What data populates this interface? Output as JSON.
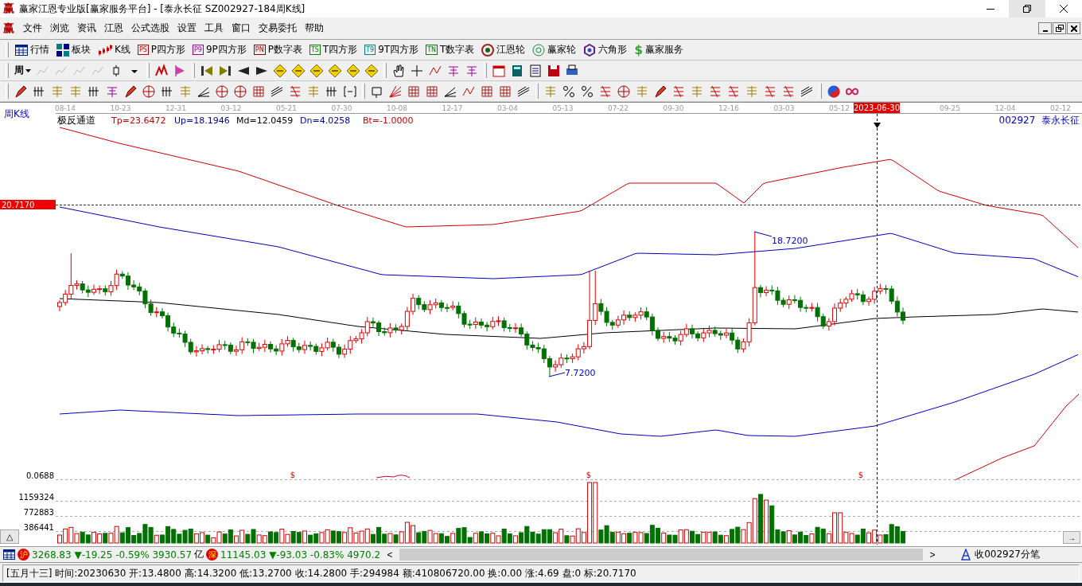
{
  "window": {
    "logo": "赢",
    "title": "赢家江恩专业版[赢家服务平台] - [泰永长征  SZ002927-184周K线]"
  },
  "menu": {
    "logo": "赢",
    "items": [
      "文件",
      "浏览",
      "资讯",
      "江恩",
      "公式选股",
      "设置",
      "工具",
      "窗口",
      "交易委托",
      "帮助"
    ]
  },
  "toolbar": [
    {
      "label": "行情",
      "kind": "table"
    },
    {
      "label": "板块",
      "kind": "blocks"
    },
    {
      "label": "K线",
      "kind": "candles"
    },
    {
      "label": "P四方形",
      "kind": "badge",
      "badge": "PS",
      "color": "#c00000"
    },
    {
      "label": "9P四方形",
      "kind": "badge",
      "badge": "P9",
      "color": "#a000a0"
    },
    {
      "label": "P数字表",
      "kind": "badge",
      "badge": "PN",
      "color": "#900000"
    },
    {
      "label": "T四方形",
      "kind": "badge",
      "badge": "TS",
      "color": "#008000"
    },
    {
      "label": "9T四方形",
      "kind": "badge",
      "badge": "T9",
      "color": "#008080"
    },
    {
      "label": "T数字表",
      "kind": "badge",
      "badge": "TN",
      "color": "#008000"
    },
    {
      "label": "江恩轮",
      "kind": "target"
    },
    {
      "label": "赢家轮",
      "kind": "wheel"
    },
    {
      "label": "六角形",
      "kind": "hexagon"
    },
    {
      "label": "赢家服务",
      "kind": "dollar",
      "glyph": "$"
    }
  ],
  "period": {
    "label": "周"
  },
  "chart": {
    "panel_label": "周K线",
    "indicator": "极反通道",
    "params": [
      {
        "text": "Tp=23.6472",
        "color": "#c00000"
      },
      {
        "text": "Up=18.1946",
        "color": "#0000a0"
      },
      {
        "text": "Md=12.0459",
        "color": "#000000"
      },
      {
        "text": "Dn=4.0258",
        "color": "#0000a0"
      },
      {
        "text": "Bt=-1.0000",
        "color": "#c00000"
      }
    ],
    "stock": "002927  泰永长征",
    "dates": [
      "08-14",
      "10-23",
      "12-31",
      "03-12",
      "05-21",
      "07-30",
      "10-08",
      "12-17",
      "03-04",
      "05-13",
      "07-22",
      "09-30",
      "12-16",
      "03-03",
      "05-12",
      "09-25",
      "12-04",
      "02-12"
    ],
    "cursor_date": "2023-06-30",
    "price_marker": "20.7170",
    "peak_label": "18.7200",
    "trough_label": "7.7200",
    "signals": [
      "$",
      "$",
      "$"
    ]
  },
  "volume": {
    "axis": [
      "0.0688",
      "1159324",
      "772883",
      "386441"
    ]
  },
  "collapse_button": "△",
  "scroll_button": "→",
  "ticker": {
    "items": [
      {
        "badge": "沪",
        "value": "3268.83 ▼-19.25 -0.59% 3930.57",
        "unit": "亿"
      },
      {
        "badge": "深",
        "value": "11145.03 ▼-93.03 -0.83% 4970.2"
      }
    ],
    "scroll_left": "<",
    "scroll_right": ">",
    "link": "收002927分笔"
  },
  "status_bar": "[五月十三] 时间:20230630 开:13.4800 高:14.3200 低:13.2700 收:14.2800 手:294984 额:410806720.00 换:0.00 涨:4.69 盘:0 标:20.7170"
}
